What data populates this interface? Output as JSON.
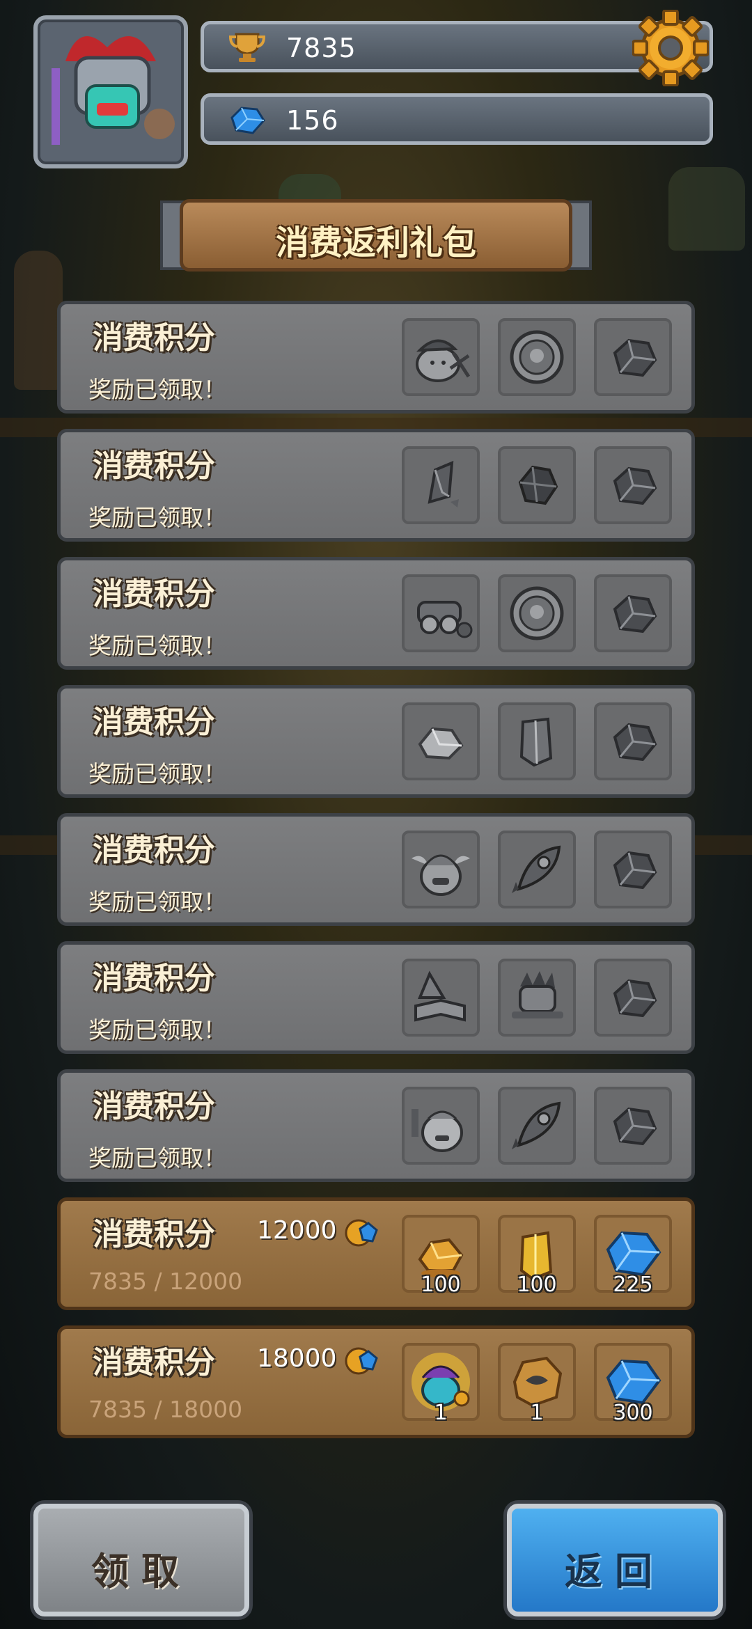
{
  "hud": {
    "trophy_count": "7835",
    "gem_count": "156",
    "trophy_icon": "trophy-icon",
    "gem_icon": "blue-gem-icon",
    "settings_icon": "gear-icon"
  },
  "title": "消费返利礼包",
  "rows": [
    {
      "title": "消费积分",
      "status": "奖励已领取！",
      "claimed": true,
      "rewards": [
        {
          "icon": "miner-blob-icon"
        },
        {
          "icon": "silver-coin-icon"
        },
        {
          "icon": "ore-chunk-icon"
        }
      ]
    },
    {
      "title": "消费积分",
      "status": "奖励已领取！",
      "claimed": true,
      "rewards": [
        {
          "icon": "crystal-shard-icon"
        },
        {
          "icon": "rough-gem-icon"
        },
        {
          "icon": "ore-chunk-icon"
        }
      ]
    },
    {
      "title": "消费积分",
      "status": "奖励已领取！",
      "claimed": true,
      "rewards": [
        {
          "icon": "goggles-hat-icon"
        },
        {
          "icon": "silver-coin-icon"
        },
        {
          "icon": "ore-chunk-icon"
        }
      ]
    },
    {
      "title": "消费积分",
      "status": "奖励已领取！",
      "claimed": true,
      "rewards": [
        {
          "icon": "rock-piece-icon"
        },
        {
          "icon": "crystal-pillar-icon"
        },
        {
          "icon": "ore-chunk-icon"
        }
      ]
    },
    {
      "title": "消费积分",
      "status": "奖励已领取！",
      "claimed": true,
      "rewards": [
        {
          "icon": "winged-hero-icon"
        },
        {
          "icon": "rocket-icon"
        },
        {
          "icon": "ore-chunk-icon"
        }
      ]
    },
    {
      "title": "消费积分",
      "status": "奖励已领取！",
      "claimed": true,
      "rewards": [
        {
          "icon": "wizard-book-icon"
        },
        {
          "icon": "knight-helmet-icon"
        },
        {
          "icon": "ore-chunk-icon"
        }
      ]
    },
    {
      "title": "消费积分",
      "status": "奖励已领取！",
      "claimed": true,
      "rewards": [
        {
          "icon": "armored-blob-icon"
        },
        {
          "icon": "rocket-icon"
        },
        {
          "icon": "ore-chunk-icon"
        }
      ]
    },
    {
      "title": "消费积分",
      "status": "7835 / 12000",
      "claimed": false,
      "cost": "12000",
      "progress": 0.653,
      "rewards": [
        {
          "icon": "gold-ore-icon",
          "qty": "100"
        },
        {
          "icon": "gold-pillar-icon",
          "qty": "100"
        },
        {
          "icon": "blue-gem-icon",
          "qty": "225"
        }
      ]
    },
    {
      "title": "消费积分",
      "status": "7835 / 18000",
      "claimed": false,
      "cost": "18000",
      "progress": 0.435,
      "rewards": [
        {
          "icon": "golden-hero-icon",
          "qty": "1"
        },
        {
          "icon": "stone-rune-icon",
          "qty": "1"
        },
        {
          "icon": "blue-gem-icon",
          "qty": "300"
        }
      ]
    }
  ],
  "buttons": {
    "claim": "领取",
    "back": "返回"
  },
  "colors": {
    "claimed_row": "#7d7e80",
    "active_row": "#a07a4c",
    "back_button": "#2f8ee0"
  }
}
